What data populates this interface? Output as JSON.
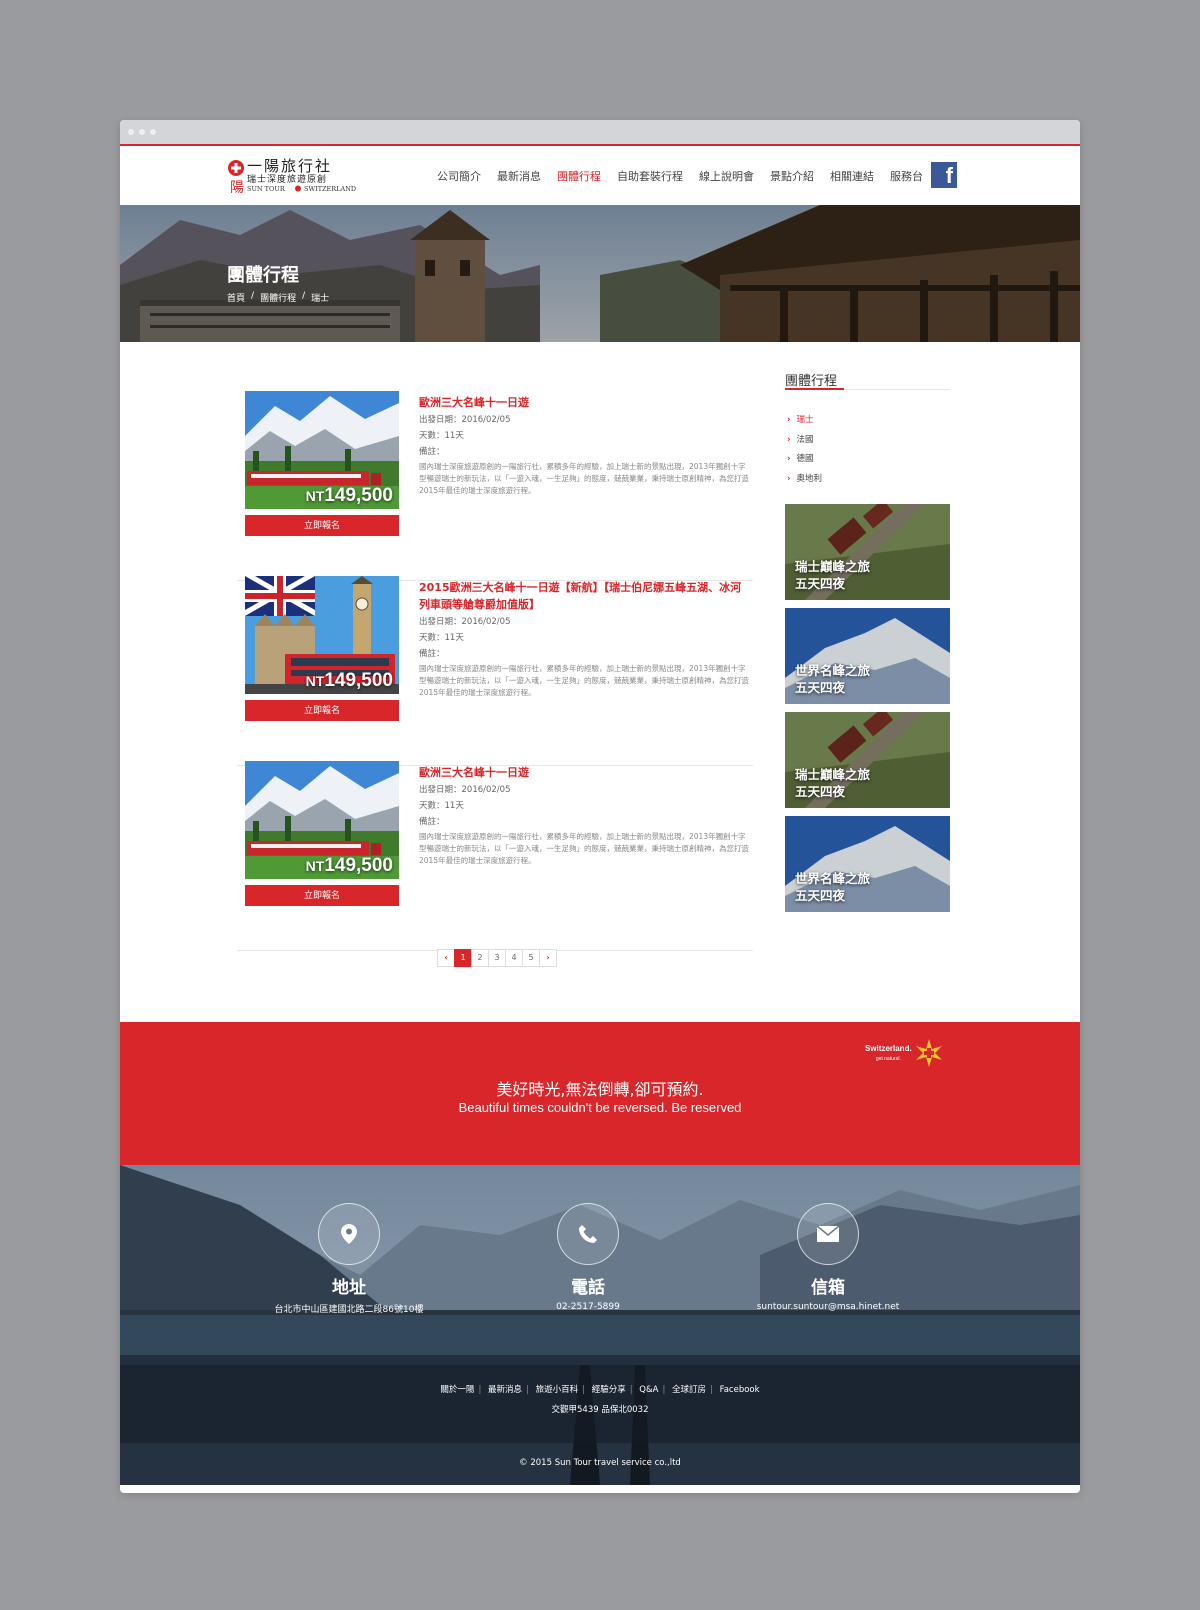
{
  "header": {
    "logo_title": "一陽旅行社",
    "logo_subtitle": "瑞士深度旅遊原創",
    "logo_en_left": "SUN TOUR",
    "logo_en_right": "SWITZERLAND",
    "logo_side_char": "陽",
    "nav": [
      "公司簡介",
      "最新消息",
      "團體行程",
      "自助套裝行程",
      "線上說明會",
      "景點介紹",
      "相關連結",
      "服務台"
    ],
    "nav_active": "團體行程",
    "facebook_icon": "facebook-icon"
  },
  "hero": {
    "title": "團體行程",
    "breadcrumb": [
      "首頁",
      "團體行程",
      "瑞士"
    ],
    "breadcrumb_sep": "/"
  },
  "tours": [
    {
      "title": "歐洲三大名峰十一日遊",
      "depart": "出發日期：2016/02/05",
      "days": "天數：11天",
      "note": "備註：",
      "desc": "國內瑞士深度旅遊原創的一陽旅行社，累積多年的經驗，加上瑞士新的景點出現，2013年獨創十字型暢遊瑞士的新玩法，以「一遊入魂，一生足夠」的態度，兢兢業業，秉持瑞士原創精神，為您打造2015年最佳的瑞士深度旅遊行程。",
      "price_prefix": "NT",
      "price": "149,500",
      "button": "立即報名",
      "image": "alps-train"
    },
    {
      "title": "2015歐洲三大名峰十一日遊【新航】【瑞士伯尼娜五峰五湖、冰河列車頭等艙尊爵加值版】",
      "depart": "出發日期：2016/02/05",
      "days": "天數：11天",
      "note": "備註：",
      "desc": "國內瑞士深度旅遊原創的一陽旅行社，累積多年的經驗，加上瑞士新的景點出現，2013年獨創十字型暢遊瑞士的新玩法，以「一遊入魂，一生足夠」的態度，兢兢業業，秉持瑞士原創精神，為您打造2015年最佳的瑞士深度旅遊行程。",
      "price_prefix": "NT",
      "price": "149,500",
      "button": "立即報名",
      "image": "london-big-ben"
    },
    {
      "title": "歐洲三大名峰十一日遊",
      "depart": "出發日期：2016/02/05",
      "days": "天數：11天",
      "note": "備註：",
      "desc": "國內瑞士深度旅遊原創的一陽旅行社，累積多年的經驗，加上瑞士新的景點出現，2013年獨創十字型暢遊瑞士的新玩法，以「一遊入魂，一生足夠」的態度，兢兢業業，秉持瑞士原創精神，為您打造2015年最佳的瑞士深度旅遊行程。",
      "price_prefix": "NT",
      "price": "149,500",
      "button": "立即報名",
      "image": "alps-train"
    }
  ],
  "pagination": {
    "pages": [
      "1",
      "2",
      "3",
      "4",
      "5"
    ],
    "current": "1",
    "prev": "‹",
    "next": "›"
  },
  "sidebar": {
    "title": "團體行程",
    "items": [
      "瑞士",
      "法國",
      "德國",
      "奧地利"
    ],
    "active": "瑞士",
    "promos": [
      {
        "line1": "瑞士巔峰之旅",
        "line2": "五天四夜",
        "image": "mountain-railway"
      },
      {
        "line1": "世界名峰之旅",
        "line2": "五天四夜",
        "image": "snow-peak"
      },
      {
        "line1": "瑞士巔峰之旅",
        "line2": "五天四夜",
        "image": "mountain-railway"
      },
      {
        "line1": "世界名峰之旅",
        "line2": "五天四夜",
        "image": "snow-peak"
      }
    ]
  },
  "banner": {
    "slogan_zh": "美好時光,無法倒轉,卻可預約.",
    "slogan_en": "Beautiful times couldn't be reversed. Be reserved",
    "brand": "Switzerland.",
    "brand_tag": "get natural."
  },
  "contacts": [
    {
      "label": "地址",
      "value": "台北市中山區建國北路二段86號10樓",
      "icon": "map-pin-icon"
    },
    {
      "label": "電話",
      "value": "02-2517-5899",
      "icon": "phone-icon"
    },
    {
      "label": "信箱",
      "value": "suntour.suntour@msa.hinet.net",
      "icon": "mail-icon"
    }
  ],
  "footer": {
    "links": [
      "關於一陽",
      "最新消息",
      "旅遊小百科",
      "經驗分享",
      "Q&A",
      "全球訂房",
      "Facebook"
    ],
    "license": "交觀甲5439 品保北0032",
    "copyright": "© 2015 Sun Tour travel service co.,ltd"
  },
  "colors": {
    "brand_red": "#d9262b",
    "facebook_blue": "#3b5998"
  }
}
